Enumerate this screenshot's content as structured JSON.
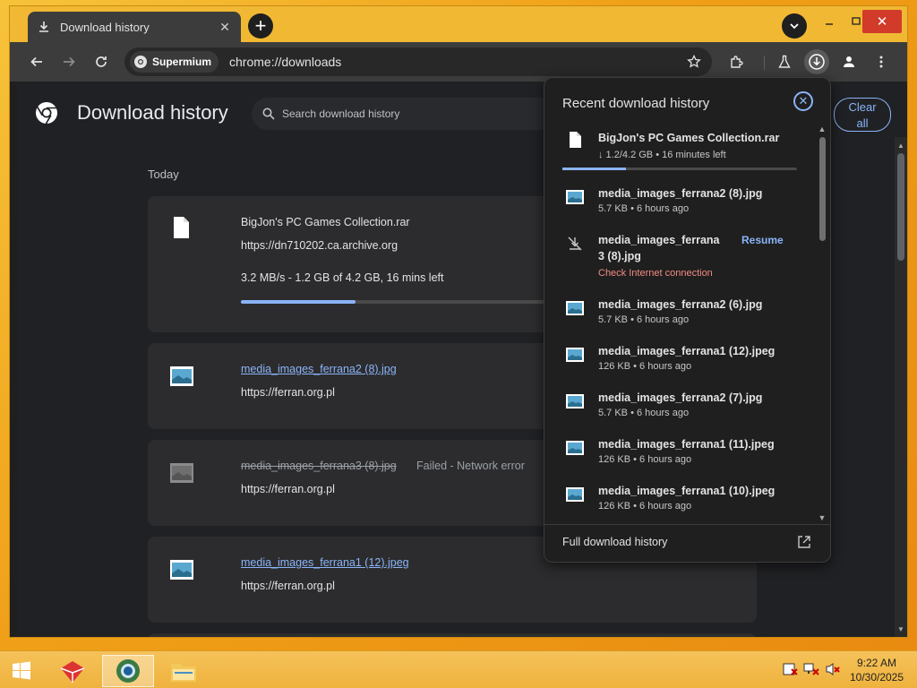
{
  "tab": {
    "title": "Download history",
    "icon": "download-icon",
    "close_icon": "close-icon"
  },
  "toolbar": {
    "site_chip": "Supermium",
    "url": "chrome://downloads"
  },
  "page": {
    "title": "Download history",
    "search_placeholder": "Search download history",
    "clear_all_line1": "Clear",
    "clear_all_line2": "all",
    "date_group": "Today",
    "items": [
      {
        "name": "BigJon's PC Games Collection.rar",
        "url": "https://dn710202.ca.archive.org",
        "progress_text": "3.2 MB/s - 1.2 GB of 4.2 GB, 16 mins left",
        "progress": 0.29
      },
      {
        "name": "media_images_ferrana2 (8).jpg",
        "url": "https://ferran.org.pl"
      },
      {
        "name": "media_images_ferrana3 (8).jpg",
        "status": "Failed - Network error",
        "url": "https://ferran.org.pl"
      },
      {
        "name": "media_images_ferrana1 (12).jpeg",
        "url": "https://ferran.org.pl"
      }
    ]
  },
  "bubble": {
    "title": "Recent download history",
    "footer_label": "Full download history",
    "resume_label": "Resume",
    "items": [
      {
        "name": "BigJon's PC Games Collection.rar",
        "sub": "↓ 1.2/4.2 GB • 16 minutes left",
        "progress": 0.27
      },
      {
        "name": "media_images_ferrana2 (8).jpg",
        "sub": "5.7 KB • 6 hours ago"
      },
      {
        "name_line1": "media_images_ferrana",
        "name_line2": "3 (8).jpg",
        "sub": "Check Internet connection"
      },
      {
        "name": "media_images_ferrana2 (6).jpg",
        "sub": "5.7 KB • 6 hours ago"
      },
      {
        "name": "media_images_ferrana1 (12).jpeg",
        "sub": "126 KB • 6 hours ago"
      },
      {
        "name": "media_images_ferrana2 (7).jpg",
        "sub": "5.7 KB • 6 hours ago"
      },
      {
        "name": "media_images_ferrana1 (11).jpeg",
        "sub": "126 KB • 6 hours ago"
      },
      {
        "name": "media_images_ferrana1 (10).jpeg",
        "sub": "126 KB • 6 hours ago"
      }
    ]
  },
  "taskbar": {
    "time": "9:22 AM",
    "date": "10/30/2025"
  },
  "colors": {
    "accent": "#8ab4f8",
    "error": "#f28b82",
    "page_bg": "#202124",
    "card_bg": "#2c2c2e"
  }
}
